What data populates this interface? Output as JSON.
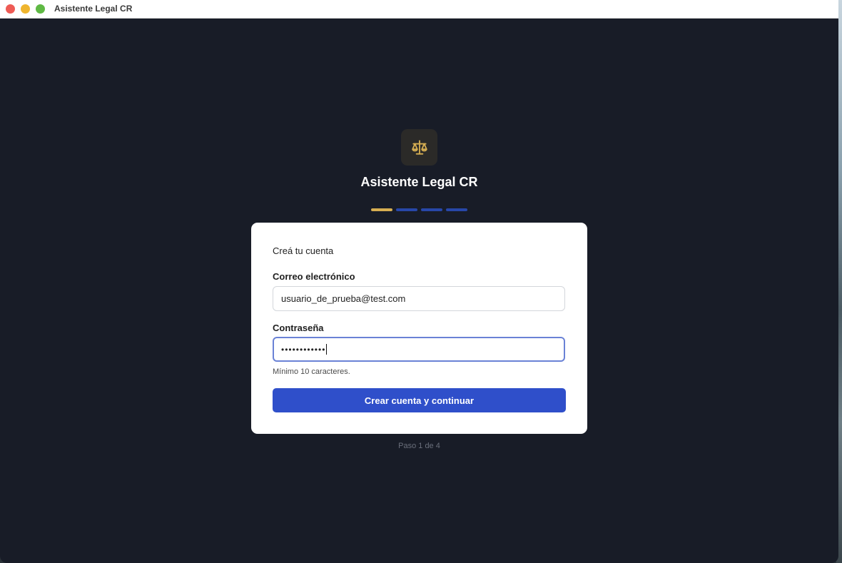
{
  "window": {
    "title": "Asistente Legal CR"
  },
  "header": {
    "app_name": "Asistente Legal CR",
    "logo_icon": "scales-icon"
  },
  "progress": {
    "total_steps": 4,
    "current_step": 1,
    "active_color": "#d6ae52",
    "inactive_color": "#2747a8"
  },
  "form": {
    "heading": "Creá tu cuenta",
    "email_label": "Correo electrónico",
    "email_value": "usuario_de_prueba@test.com",
    "password_label": "Contraseña",
    "password_mask": "••••••••••••",
    "password_hint": "Mínimo 10 caracteres.",
    "submit_label": "Crear cuenta y continuar"
  },
  "footer": {
    "step_text": "Paso 1 de 4"
  },
  "colors": {
    "background": "#181c27",
    "primary": "#2f4fca",
    "accent": "#d6ae52"
  }
}
